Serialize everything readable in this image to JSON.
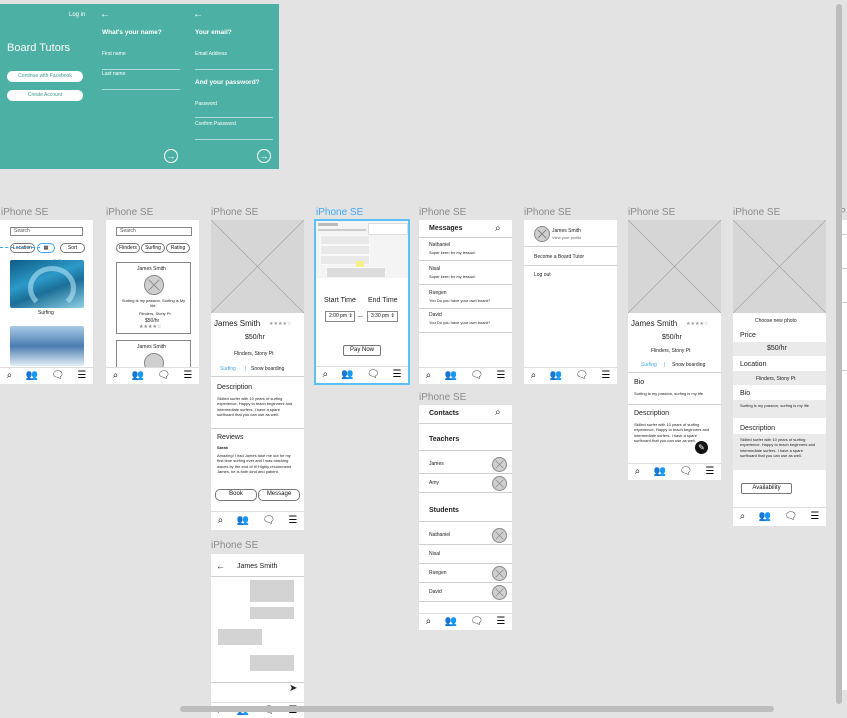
{
  "onboarding": {
    "login": "Log in",
    "app_title": "Board Tutors",
    "facebook_btn": "Continue with Facebook",
    "create_btn": "Create Account",
    "name_q": "What's your name?",
    "first_name": "First name",
    "last_name": "Last name",
    "email_q": "Your email?",
    "email_field": "Email Address",
    "password_q": "And your password?",
    "password_field": "Password",
    "confirm_field": "Confirm Password"
  },
  "frame_label": "iPhone SE",
  "search": {
    "placeholder": "Search",
    "location": "Location",
    "sort": "Sort",
    "count": "22",
    "photo1_caption": "Surfing",
    "filters": [
      "Flinders",
      "Surfing",
      "Rating"
    ]
  },
  "card": {
    "name": "James Smith",
    "bio": "Surfing is my passion, Surfing is My life.",
    "location": "Flinders, Stony Pt",
    "price": "$50/hr"
  },
  "profile": {
    "name": "James Smith",
    "price": "$50/hr",
    "location": "Flinders, Stony Pt",
    "tags": [
      "Surfing",
      "Snow boarding"
    ],
    "description_title": "Description",
    "description": "Skilled surfer with 10 years of surfing experience. Happy to teach beginners and intermediate surfers. I have a spare surfboard that you can use as well.",
    "reviews_title": "Reviews",
    "reviewer": "Sarah",
    "review": "Amazing! I had James take me out for my first time surfing ever and I was catching waves by the end of it! Highly recommend James, he is both kind and patient.",
    "book": "Book",
    "message": "Message"
  },
  "booking": {
    "start_label": "Start Time",
    "end_label": "End Time",
    "start_time": "2:00 pm",
    "end_time": "3:30 pm",
    "dash": "—",
    "pay": "Pay Now"
  },
  "messages": {
    "title": "Messages",
    "items": [
      {
        "name": "Nathaniel",
        "text": "Super keen for my lesson!"
      },
      {
        "name": "Nisal",
        "text": "Super keen for my lesson!"
      },
      {
        "name": "Ruegen",
        "text": "You Do you have your own board?"
      },
      {
        "name": "David",
        "text": "You Do you have your own board?"
      }
    ]
  },
  "contacts": {
    "title": "Contacts",
    "teachers": "Teachers",
    "teacher_list": [
      "James",
      "Amy"
    ],
    "students": "Students",
    "student_list": [
      "Nathaniel",
      "Nisal",
      "Ruegen",
      "David"
    ]
  },
  "menu": {
    "name": "James Smith",
    "view": "View your profile",
    "become": "Become a Board Tutor",
    "logout": "Log out"
  },
  "myprofile": {
    "bio_title": "Bio",
    "bio": "Surfing is my passion, surfing is my life"
  },
  "edit": {
    "choose_photo": "Choose new photo",
    "price_label": "Price",
    "location_label": "Location",
    "bio_label": "Bio",
    "description_label": "Description",
    "availability": "Availability"
  },
  "chat": {
    "name": "James Smith"
  },
  "colors": {
    "teal": "#4db0a4",
    "selection": "#3fa9f5"
  }
}
